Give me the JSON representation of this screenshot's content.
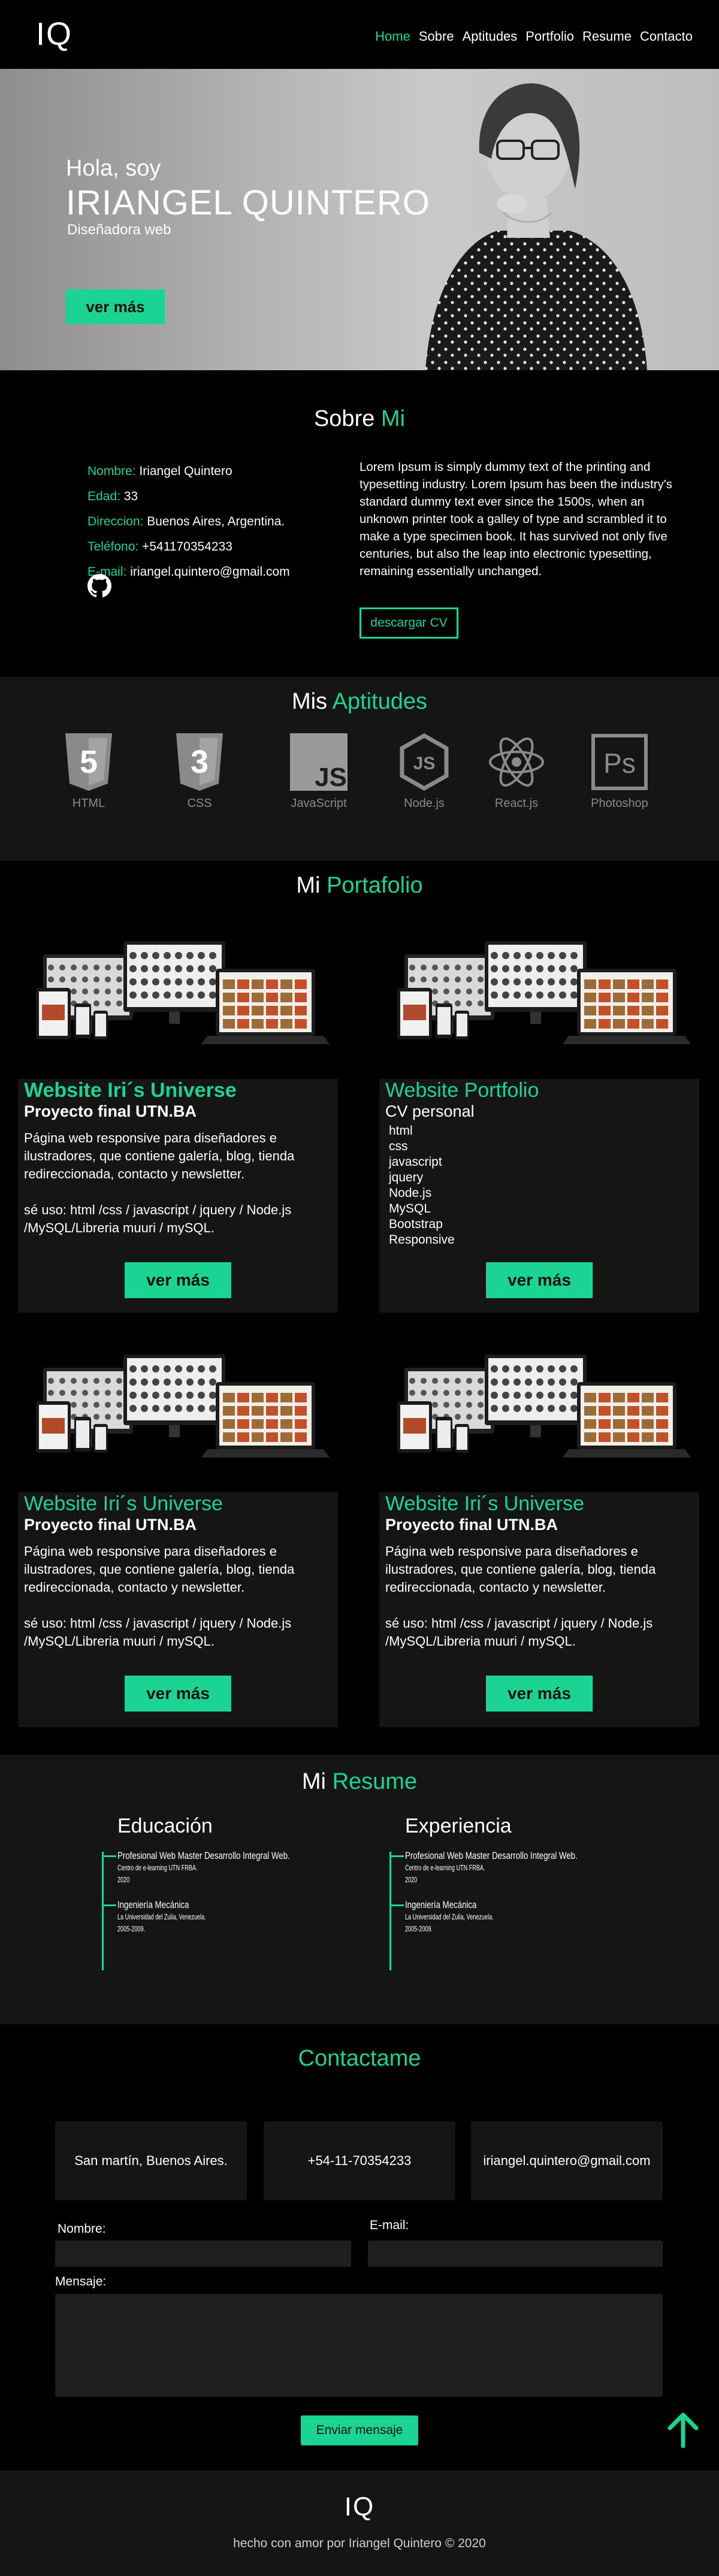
{
  "nav": {
    "logo": "IQ",
    "links": [
      "Home",
      "Sobre",
      "Aptitudes",
      "Portfolio",
      "Resume",
      "Contacto"
    ]
  },
  "hero": {
    "greeting": "Hola, soy",
    "name": "IRIANGEL QUINTERO",
    "role": "Diseñadora web",
    "button": "ver más"
  },
  "about": {
    "title_a": "Sobre",
    "title_b": "Mi",
    "fields": [
      {
        "label": "Nombre:",
        "value": "Iriangel Quintero"
      },
      {
        "label": "Edad:",
        "value": "33"
      },
      {
        "label": "Direccion:",
        "value": "Buenos Aires, Argentina."
      },
      {
        "label": "Teléfono:",
        "value": "+541170354233"
      },
      {
        "label": "E-mail:",
        "value": "iriangel.quintero@gmail.com"
      }
    ],
    "text": "Lorem Ipsum is simply dummy text of the printing and typesetting industry. Lorem Ipsum has been the industry's standard dummy text ever since the 1500s, when an unknown printer took a galley of type and scrambled it to make a type specimen book. It has survived not only five centuries, but also the leap into electronic typesetting, remaining essentially unchanged.",
    "cv_button": "descargar CV"
  },
  "skills": {
    "title_a": "Mis",
    "title_b": "Aptitudes",
    "items": [
      "HTML",
      "CSS",
      "JavaScript",
      "Node.js",
      "React.js",
      "Photoshop"
    ],
    "badges": [
      "5",
      "3",
      "JS",
      "JS",
      "",
      "Ps"
    ]
  },
  "portfolio": {
    "title_a": "Mi",
    "title_b": "Portafolio",
    "cards": [
      {
        "title": "Website Iri´s Universe",
        "subtitle": "Proyecto final UTN.BA",
        "desc": "Página web responsive para diseñadores e ilustradores, que contiene galería, blog, tienda redireccionada, contacto y newsletter.",
        "uses": "sé uso: html /css / javascript / jquery / Node.js /MySQL/Libreria muuri / mySQL.",
        "button": "ver más"
      },
      {
        "title": "Website Portfolio",
        "subtitle": "CV personal",
        "list": [
          "html",
          "css",
          "javascript",
          "jquery",
          "Node.js",
          "MySQL",
          "Bootstrap",
          "Responsive"
        ],
        "button": "ver más"
      },
      {
        "title": "Website Iri´s Universe",
        "subtitle": "Proyecto final UTN.BA",
        "desc": "Página web responsive para diseñadores e ilustradores, que contiene galería, blog, tienda redireccionada, contacto y newsletter.",
        "uses": "sé uso: html /css / javascript / jquery / Node.js /MySQL/Libreria muuri / mySQL.",
        "button": "ver más"
      },
      {
        "title": "Website Iri´s Universe",
        "subtitle": "Proyecto final UTN.BA",
        "desc": "Página web responsive para diseñadores e ilustradores, que contiene galería, blog, tienda redireccionada, contacto y newsletter.",
        "uses": "sé uso: html /css / javascript / jquery / Node.js /MySQL/Libreria muuri / mySQL.",
        "button": "ver más"
      }
    ]
  },
  "resume": {
    "title_a": "Mi",
    "title_b": "Resume",
    "education": {
      "heading": "Educación",
      "items": [
        {
          "title": "Profesional Web Master Desarrollo Integral Web.",
          "lines": [
            "Centro de e-learning UTN FRBA.",
            "2020"
          ]
        },
        {
          "title": "Ingeniería Mecánica",
          "lines": [
            "La Universidad del Zulia, Venezuela.",
            "2005-2009."
          ]
        }
      ]
    },
    "experience": {
      "heading": "Experiencia",
      "items": [
        {
          "title": "Profesional Web Master Desarrollo Integral Web.",
          "lines": [
            "Centro de e-learning UTN FRBA.",
            "2020"
          ]
        },
        {
          "title": "Ingeniería Mecánica",
          "lines": [
            "La Universidad del Zulia, Venezuela.",
            "2005-2009."
          ]
        }
      ]
    }
  },
  "contact": {
    "title": "Contactame",
    "address": "San martín, Buenos Aires.",
    "phone": "+54-11-70354233",
    "email": "iriangel.quintero@gmail.com",
    "name_label": "Nombre:",
    "email_label": "E-mail:",
    "message_label": "Mensaje:",
    "send_button": "Enviar mensaje"
  },
  "footer": {
    "logo": "IQ",
    "note": "hecho con amor por Iriangel Quintero © 2020"
  },
  "colors": {
    "accent": "#1bd494",
    "background": "#000000",
    "panel": "#151515"
  }
}
